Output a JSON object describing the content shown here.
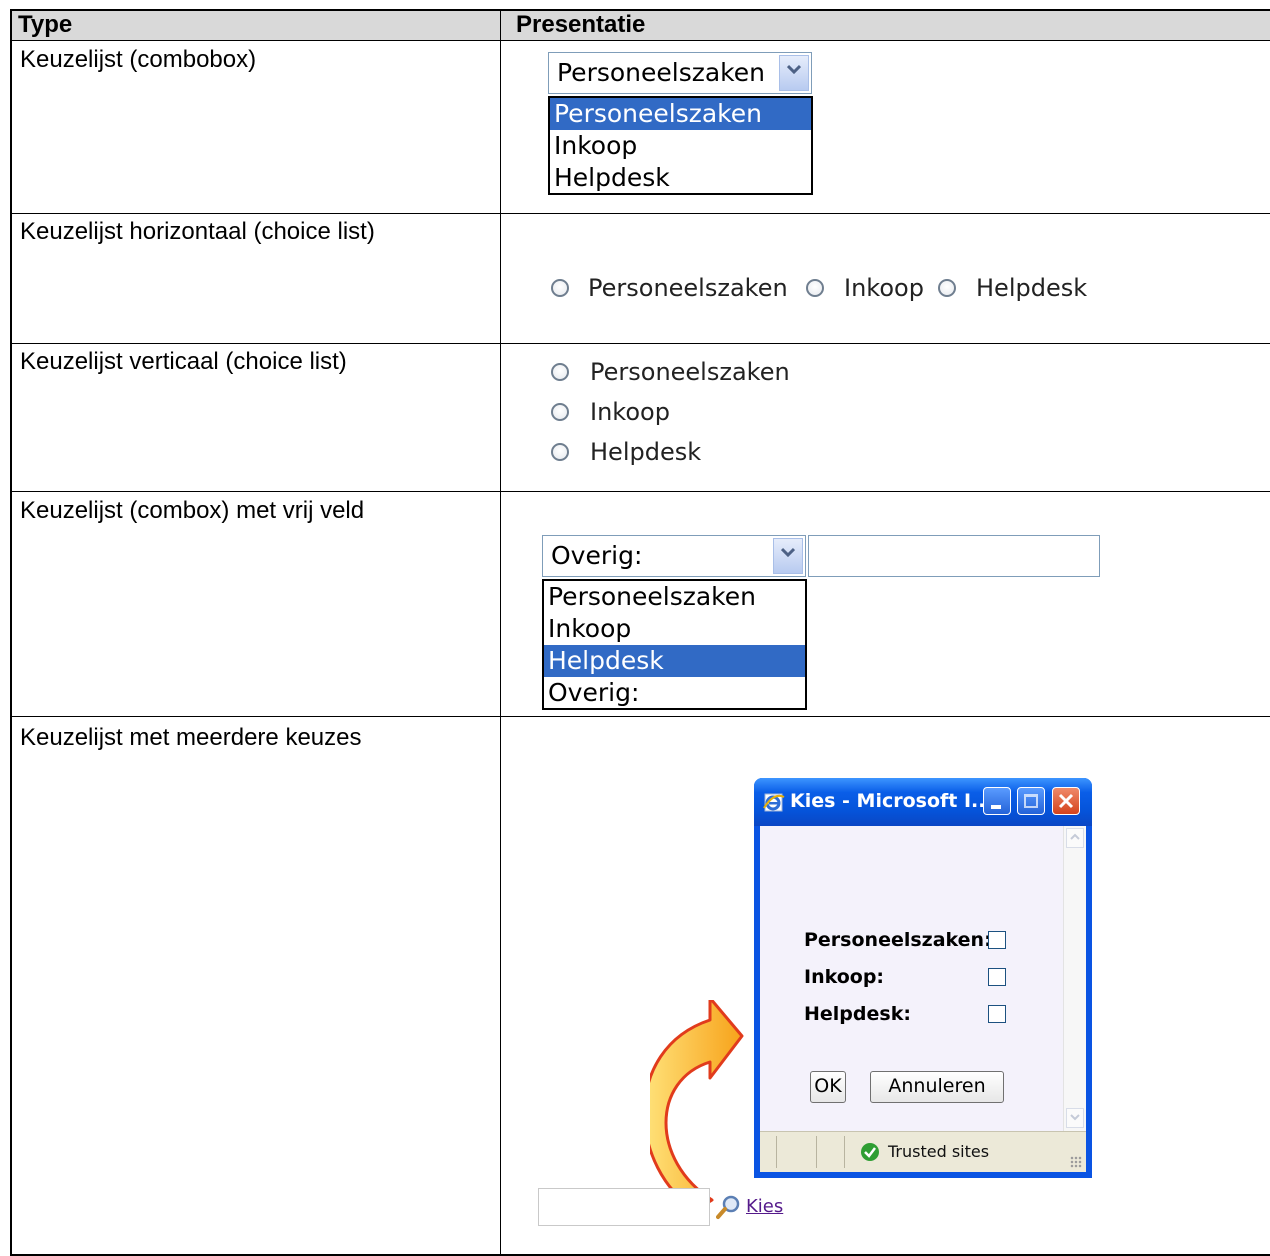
{
  "table": {
    "headers": [
      "Type",
      "Presentatie"
    ],
    "rows": [
      "Keuzelijst (combobox)",
      "Keuzelijst horizontaal (choice list)",
      "Keuzelijst verticaal (choice list)",
      "Keuzelijst (combox) met vrij veld",
      "Keuzelijst met meerdere keuzes"
    ]
  },
  "combobox": {
    "selected": "Personeelszaken",
    "options": [
      "Personeelszaken",
      "Inkoop",
      "Helpdesk"
    ],
    "highlighted": "Personeelszaken"
  },
  "radio_horizontal": [
    "Personeelszaken",
    "Inkoop",
    "Helpdesk"
  ],
  "radio_vertical": [
    "Personeelszaken",
    "Inkoop",
    "Helpdesk"
  ],
  "combobox_free": {
    "selected": "Overig:",
    "options": [
      "Personeelszaken",
      "Inkoop",
      "Helpdesk",
      "Overig:"
    ],
    "highlighted": "Helpdesk",
    "free_value": ""
  },
  "dialog": {
    "title": "Kies - Microsoft I...",
    "items": [
      "Personeelszaken:",
      "Inkoop:",
      "Helpdesk:"
    ],
    "ok_label": "OK",
    "cancel_label": "Annuleren",
    "status": "Trusted sites"
  },
  "picker": {
    "value": "",
    "link_label": "Kies"
  },
  "colors": {
    "selection": "#316ac5",
    "header_bg": "#d9d9d9",
    "xp_blue": "#0a54e3",
    "arrow_orange": "#f4a21a"
  }
}
